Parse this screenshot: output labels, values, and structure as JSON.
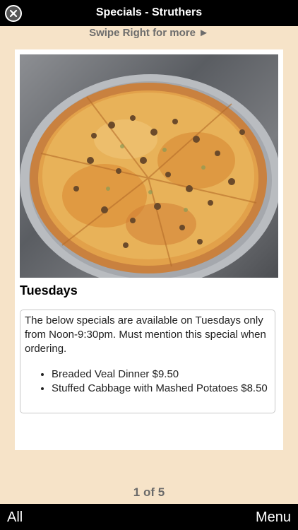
{
  "header": {
    "title": "Specials - Struthers",
    "close_icon": "close-icon"
  },
  "swipe_hint": "Swipe Right for more ►",
  "special": {
    "day": "Tuesdays",
    "description": "The below specials are available on Tuesdays only from Noon-9:30pm. Must mention this special when ordering.",
    "items": [
      "Breaded Veal Dinner $9.50",
      "Stuffed Cabbage with Mashed Potatoes $8.50"
    ]
  },
  "pager": "1 of 5",
  "footer": {
    "left_label": "All",
    "right_label": "Menu"
  }
}
